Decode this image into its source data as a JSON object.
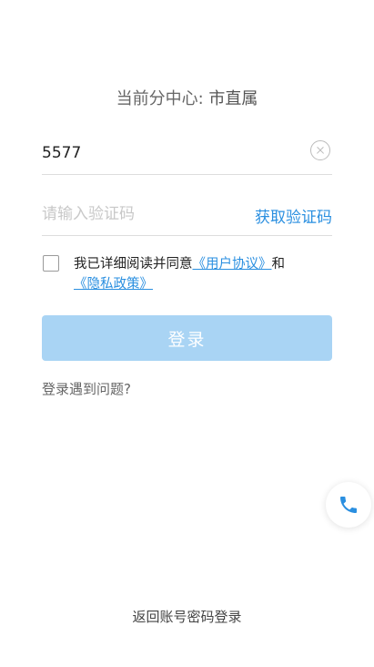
{
  "center": {
    "label": "当前分中心:",
    "value": "市直属"
  },
  "phone": {
    "value": "5577"
  },
  "code": {
    "placeholder": "请输入验证码",
    "get_code_label": "获取验证码"
  },
  "agreement": {
    "prefix": "我已详细阅读并同意",
    "user_agreement": "《用户协议》",
    "conjunction": "和",
    "privacy_policy": "《隐私政策》",
    "checked": false
  },
  "login_button": {
    "label": "登录"
  },
  "problem_link": "登录遇到问题?",
  "return_link": "返回账号密码登录",
  "colors": {
    "accent": "#2a8fe0",
    "button_bg": "#a9d4f4"
  },
  "icons": {
    "clear": "clear-circle-icon",
    "phone": "phone-icon"
  }
}
